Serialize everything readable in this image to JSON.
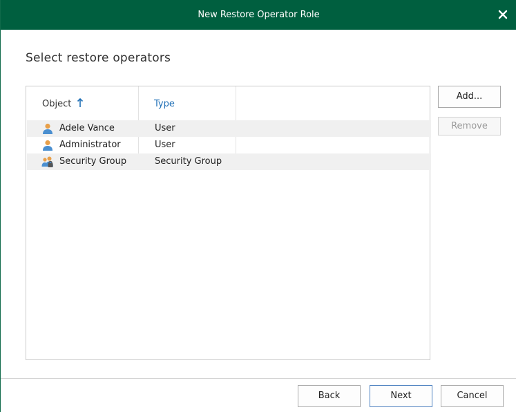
{
  "window": {
    "title": "New Restore Operator Role"
  },
  "page": {
    "heading": "Select restore operators"
  },
  "table": {
    "columns": [
      {
        "label": "Object",
        "sort": "ascending"
      },
      {
        "label": "Type"
      }
    ],
    "rows": [
      {
        "name": "Adele Vance",
        "type": "User",
        "icon": "user-icon"
      },
      {
        "name": "Administrator",
        "type": "User",
        "icon": "user-icon"
      },
      {
        "name": "Security Group",
        "type": "Security Group",
        "icon": "security-group-icon"
      }
    ]
  },
  "side_buttons": {
    "add": "Add...",
    "remove": "Remove"
  },
  "footer": {
    "back": "Back",
    "next": "Next",
    "cancel": "Cancel"
  },
  "colors": {
    "titlebar": "#005f3f",
    "header_link": "#1f6fb6",
    "alt_row": "#f0f0f0"
  }
}
